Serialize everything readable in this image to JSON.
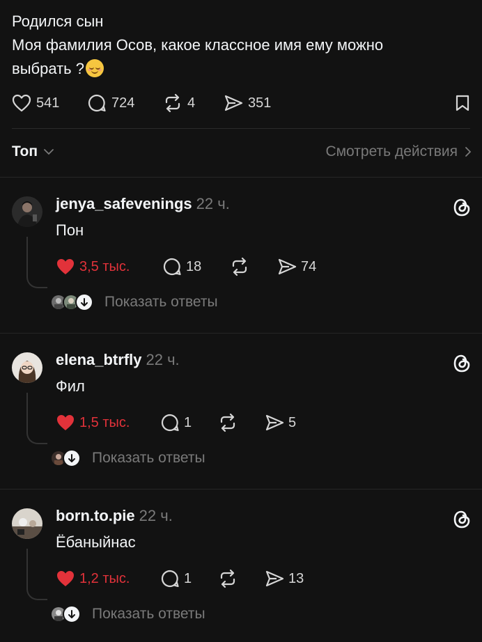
{
  "post": {
    "line1": "Родился сын",
    "line2": "Моя фамилия Осов, какое классное имя ему можно",
    "line3": "выбрать ?",
    "emoji": "relieved-face",
    "likes": "541",
    "comments": "724",
    "reposts": "4",
    "shares": "351"
  },
  "sort": {
    "label": "Топ",
    "view_activity": "Смотреть действия"
  },
  "comments": [
    {
      "username": "jenya_safevenings",
      "time": "22 ч.",
      "text": "Пон",
      "likes": "3,5 тыс.",
      "replies": "18",
      "reposts": "",
      "shares": "74",
      "show_replies": "Показать ответы"
    },
    {
      "username": "elena_btrfly",
      "time": "22 ч.",
      "text": "Фил",
      "likes": "1,5 тыс.",
      "replies": "1",
      "reposts": "",
      "shares": "5",
      "show_replies": "Показать ответы"
    },
    {
      "username": "born.to.pie",
      "time": "22 ч.",
      "text": "Ёбаныйнас",
      "likes": "1,2 тыс.",
      "replies": "1",
      "reposts": "",
      "shares": "13",
      "show_replies": "Показать ответы"
    }
  ],
  "colors": {
    "background": "#121212",
    "like_red": "#e2323a",
    "muted": "#7a7a7a"
  }
}
